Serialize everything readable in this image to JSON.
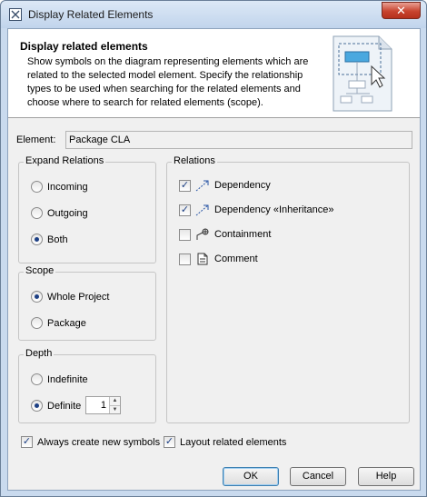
{
  "window": {
    "title": "Display Related Elements",
    "close_symbol": "✕"
  },
  "header": {
    "title": "Display related elements",
    "description": "Show symbols on the diagram representing elements which are related to the selected model element. Specify the relationship types to be used when searching for the related elements and choose where to search for related elements (scope)."
  },
  "element": {
    "label": "Element:",
    "value": "Package CLA"
  },
  "expand_relations": {
    "title": "Expand Relations",
    "options": [
      {
        "label": "Incoming",
        "selected": false
      },
      {
        "label": "Outgoing",
        "selected": false
      },
      {
        "label": "Both",
        "selected": true
      }
    ]
  },
  "scope": {
    "title": "Scope",
    "options": [
      {
        "label": "Whole Project",
        "selected": true
      },
      {
        "label": "Package",
        "selected": false
      }
    ]
  },
  "depth": {
    "title": "Depth",
    "options": [
      {
        "label": "Indefinite",
        "selected": false
      },
      {
        "label": "Definite",
        "selected": true
      }
    ],
    "definite_value": "1"
  },
  "relations": {
    "title": "Relations",
    "items": [
      {
        "label": "Dependency",
        "checked": true,
        "icon": "dependency-icon"
      },
      {
        "label": "Dependency «Inheritance»",
        "checked": true,
        "icon": "dependency-icon"
      },
      {
        "label": "Containment",
        "checked": false,
        "icon": "containment-icon"
      },
      {
        "label": "Comment",
        "checked": false,
        "icon": "comment-icon"
      }
    ]
  },
  "options": {
    "always_create": {
      "label": "Always create new symbols",
      "checked": true
    },
    "layout_related": {
      "label": "Layout related elements",
      "checked": true
    }
  },
  "buttons": {
    "ok": "OK",
    "cancel": "Cancel",
    "help": "Help"
  },
  "colors": {
    "accent": "#1c3f84",
    "titlebar": "#c9daee",
    "close": "#c8442f"
  }
}
